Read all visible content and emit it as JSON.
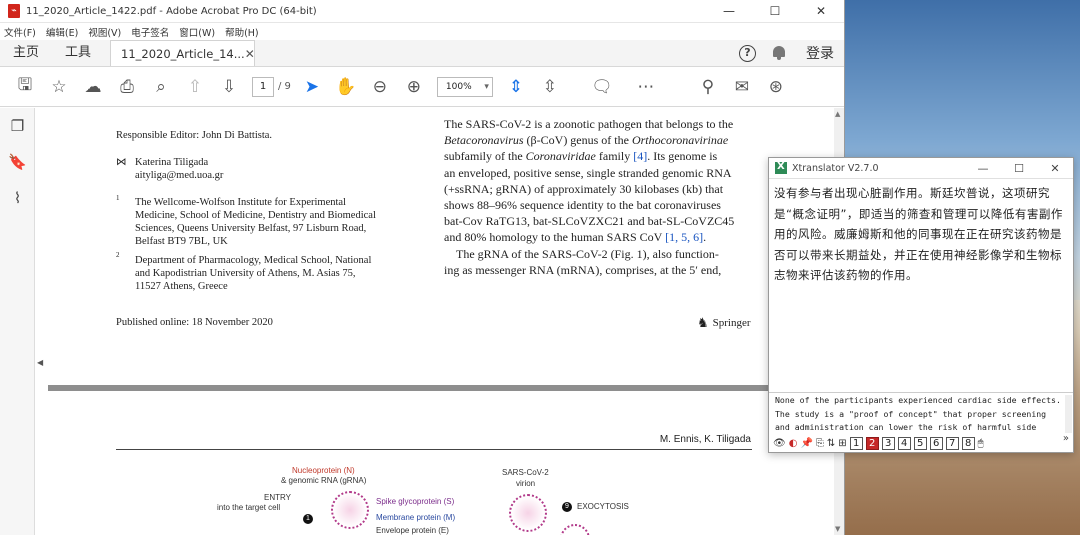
{
  "acrobat": {
    "title": "11_2020_Article_1422.pdf - Adobe Acrobat Pro DC (64-bit)",
    "menu": [
      "文件(F)",
      "编辑(E)",
      "视图(V)",
      "电子签名",
      "窗口(W)",
      "帮助(H)"
    ],
    "nav_tabs": [
      "主页",
      "工具"
    ],
    "doc_tab": "11_2020_Article_14...",
    "login": "登录",
    "page_current": "1",
    "page_total": "/ 9",
    "zoom": "100%"
  },
  "page1": {
    "editor": "Responsible Editor: John Di Battista.",
    "author_name": "Katerina Tiligada",
    "author_email": "aityliga@med.uoa.gr",
    "aff1_num": "1",
    "aff1": [
      "The Wellcome-Wolfson Institute for Experimental",
      "Medicine, School of Medicine, Dentistry and Biomedical",
      "Sciences, Queens University Belfast, 97 Lisburn Road,",
      "Belfast BT9 7BL, UK"
    ],
    "aff2_num": "2",
    "aff2": [
      "Department of Pharmacology, Medical School, National",
      "and Kapodistrian University of Athens, M. Asias 75,",
      "11527 Athens, Greece"
    ],
    "published": "Published online: 18 November 2020",
    "publisher": "Springer",
    "col_lines": {
      "l1": "The SARS-CoV-2 is a zoonotic pathogen that belongs to the",
      "l2a": "Betacoronavirus",
      "l2b": " (β-CoV) genus of the ",
      "l2c": "Orthocoronavirinae",
      "l3a": "subfamily of the ",
      "l3b": "Coronaviridae",
      "l3c": " family ",
      "l3ref": "[4]",
      "l3d": ". Its genome is",
      "l4": "an enveloped, positive sense, single stranded genomic RNA",
      "l5": "(+ssRNA; gRNA) of approximately 30 kilobases (kb) that",
      "l6": "shows 88–96% sequence identity to the bat coronaviruses",
      "l7": "bat-Cov RaTG13, bat-SLCoVZXC21 and bat-SL-CoVZC45",
      "l8a": "and 80% homology to the human SARS CoV ",
      "l8ref": "[1, 5, 6]",
      "l8b": ".",
      "l9": "The gRNA of the SARS-CoV-2 (Fig. 1), also function-",
      "l10": "ing as messenger RNA (mRNA), comprises, at the 5′ end,"
    }
  },
  "page2": {
    "header": "M. Ennis, K. Tiligada",
    "fig_nucleoprotein": "Nucleoprotein (N)",
    "fig_grna": "& genomic RNA (gRNA)",
    "fig_entry": "ENTRY",
    "fig_into": "into the target cell",
    "fig_step1": "1",
    "fig_spike": "Spike glycoprotein (S)",
    "fig_membrane": "Membrane protein (M)",
    "fig_envelope": "Envelope protein (E)",
    "fig_virion_name": "SARS-CoV-2",
    "fig_virion": "virion",
    "fig_step9": "9",
    "fig_exocytosis": "EXOCYTOSIS"
  },
  "xtranslator": {
    "title": "Xtranslator V2.7.0",
    "output": "没有参与者出现心脏副作用。斯廷坎普说，这项研究是“概念证明”，即适当的筛查和管理可以降低有害副作用的风险。威廉姆斯和他的同事现在正在研究该药物是否可以带来长期益处，并正在使用神经影像学和生物标志物来评估该药物的作用。",
    "input": [
      "None of the participants experienced cardiac side effects.",
      "The study is a \"proof of concept\" that proper screening",
      "and administration can lower the risk of harmful side"
    ],
    "numbers": [
      "1",
      "2",
      "3",
      "4",
      "5",
      "6",
      "7",
      "8"
    ],
    "active_number": "2",
    "more": "»"
  }
}
